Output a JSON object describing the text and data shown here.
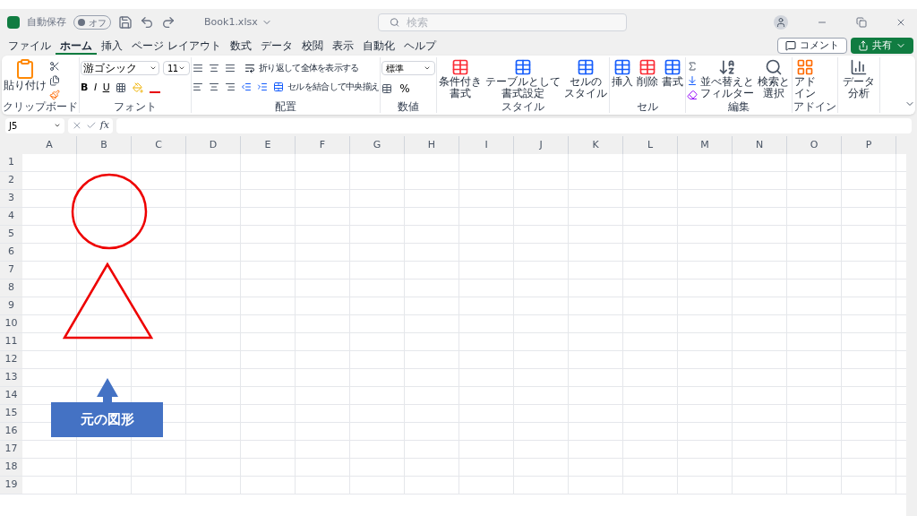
{
  "title_bar": {
    "autosave_label": "自動保存",
    "autosave_toggle": {
      "label": "オフ",
      "on": false
    },
    "file_name": "Book1.xlsx",
    "search_placeholder": "検索"
  },
  "menu_tabs": [
    {
      "label": "ファイル",
      "selected": false
    },
    {
      "label": "ホーム",
      "selected": true
    },
    {
      "label": "挿入",
      "selected": false
    },
    {
      "label": "ページ レイアウト",
      "selected": false
    },
    {
      "label": "数式",
      "selected": false
    },
    {
      "label": "データ",
      "selected": false
    },
    {
      "label": "校閲",
      "selected": false
    },
    {
      "label": "表示",
      "selected": false
    },
    {
      "label": "自動化",
      "selected": false
    },
    {
      "label": "ヘルプ",
      "selected": false
    }
  ],
  "comment_button": "コメント",
  "share_button": "共有",
  "ribbon": {
    "clipboard": {
      "paste": "貼り付け",
      "label": "クリップボード"
    },
    "font": {
      "font_name": "游ゴシック",
      "font_size": "11",
      "styles": [
        "B",
        "I",
        "U"
      ],
      "label": "フォント"
    },
    "alignment": {
      "wrap": "折り返して全体を表示する",
      "merge": "セルを結合して中央揃え",
      "label": "配置"
    },
    "number": {
      "format": "標準",
      "percent": "%",
      "label": "数値"
    },
    "styles": {
      "buttons": [
        [
          "条件付き",
          "書式"
        ],
        [
          "テーブルとして",
          "書式設定"
        ],
        [
          "セルの",
          "スタイル"
        ]
      ],
      "label": "スタイル"
    },
    "cells": {
      "buttons": [
        "挿入",
        "削除",
        "書式"
      ],
      "label": "セル"
    },
    "editing": {
      "buttons": [
        [
          "並べ替えと",
          "フィルター"
        ],
        [
          "検索と",
          "選択"
        ]
      ],
      "label": "編集"
    },
    "addins": {
      "button": [
        "アド",
        "イン"
      ],
      "label": "アドイン"
    },
    "analysis": {
      "button": [
        "データ",
        "分析"
      ]
    }
  },
  "formula_bar": {
    "name_box": "J5",
    "fx": "fx"
  },
  "columns": [
    "A",
    "B",
    "C",
    "D",
    "E",
    "F",
    "G",
    "H",
    "I",
    "J",
    "K",
    "L",
    "M",
    "N",
    "O",
    "P"
  ],
  "rows": [
    "1",
    "2",
    "3",
    "4",
    "5",
    "6",
    "7",
    "8",
    "9",
    "10",
    "11",
    "12",
    "13",
    "14",
    "15",
    "16",
    "17",
    "18",
    "19"
  ],
  "callout": {
    "text": "元の図形"
  }
}
